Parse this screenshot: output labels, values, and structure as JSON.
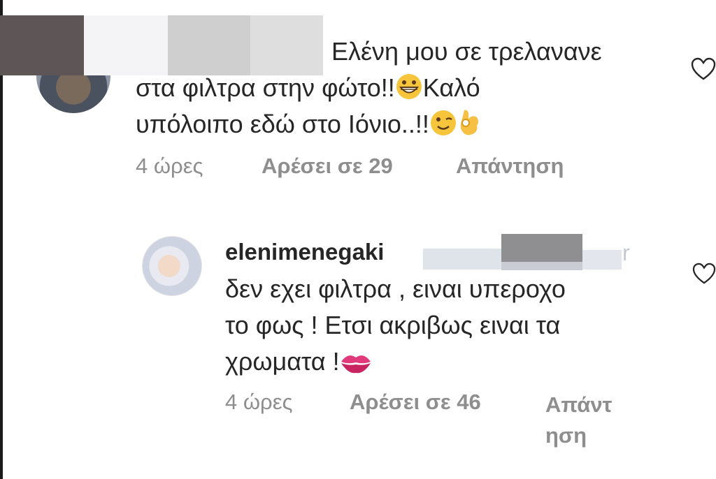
{
  "comments": [
    {
      "lines": [
        "Ελένη μου σε τρελανανε",
        "στα φιλτρα στην φώτο!!",
        "υπόλοιπο εδώ στο Ιόνιο..!!"
      ],
      "line2_after_emoji": "Καλό",
      "time": "4 ώρες",
      "likes": "Αρέσει σε 29",
      "reply": "Απάντηση",
      "emojis": [
        "grinning-face-icon",
        "winking-face-icon",
        "ok-hand-icon"
      ]
    },
    {
      "username": "elenimenegaki",
      "mention_tail": "r",
      "lines": [
        "δεν εχει φιλτρα , ειναι υπεροχο",
        "το φως ! Ετσι ακριβως ειναι τα",
        "χρωματα !"
      ],
      "time": "4 ώρες",
      "likes": "Αρέσει σε 46",
      "reply_part1": "Απάντ",
      "reply_part2": "ηση",
      "emojis": [
        "kiss-mark-icon"
      ]
    }
  ],
  "colors": {
    "text": "#262626",
    "meta": "#8e8e8e",
    "heart": "#262626",
    "pixelate_dark": "#5e5656",
    "pixelate_mid": "#cfcfcf",
    "pixelate_light": "#f4f3f5"
  }
}
